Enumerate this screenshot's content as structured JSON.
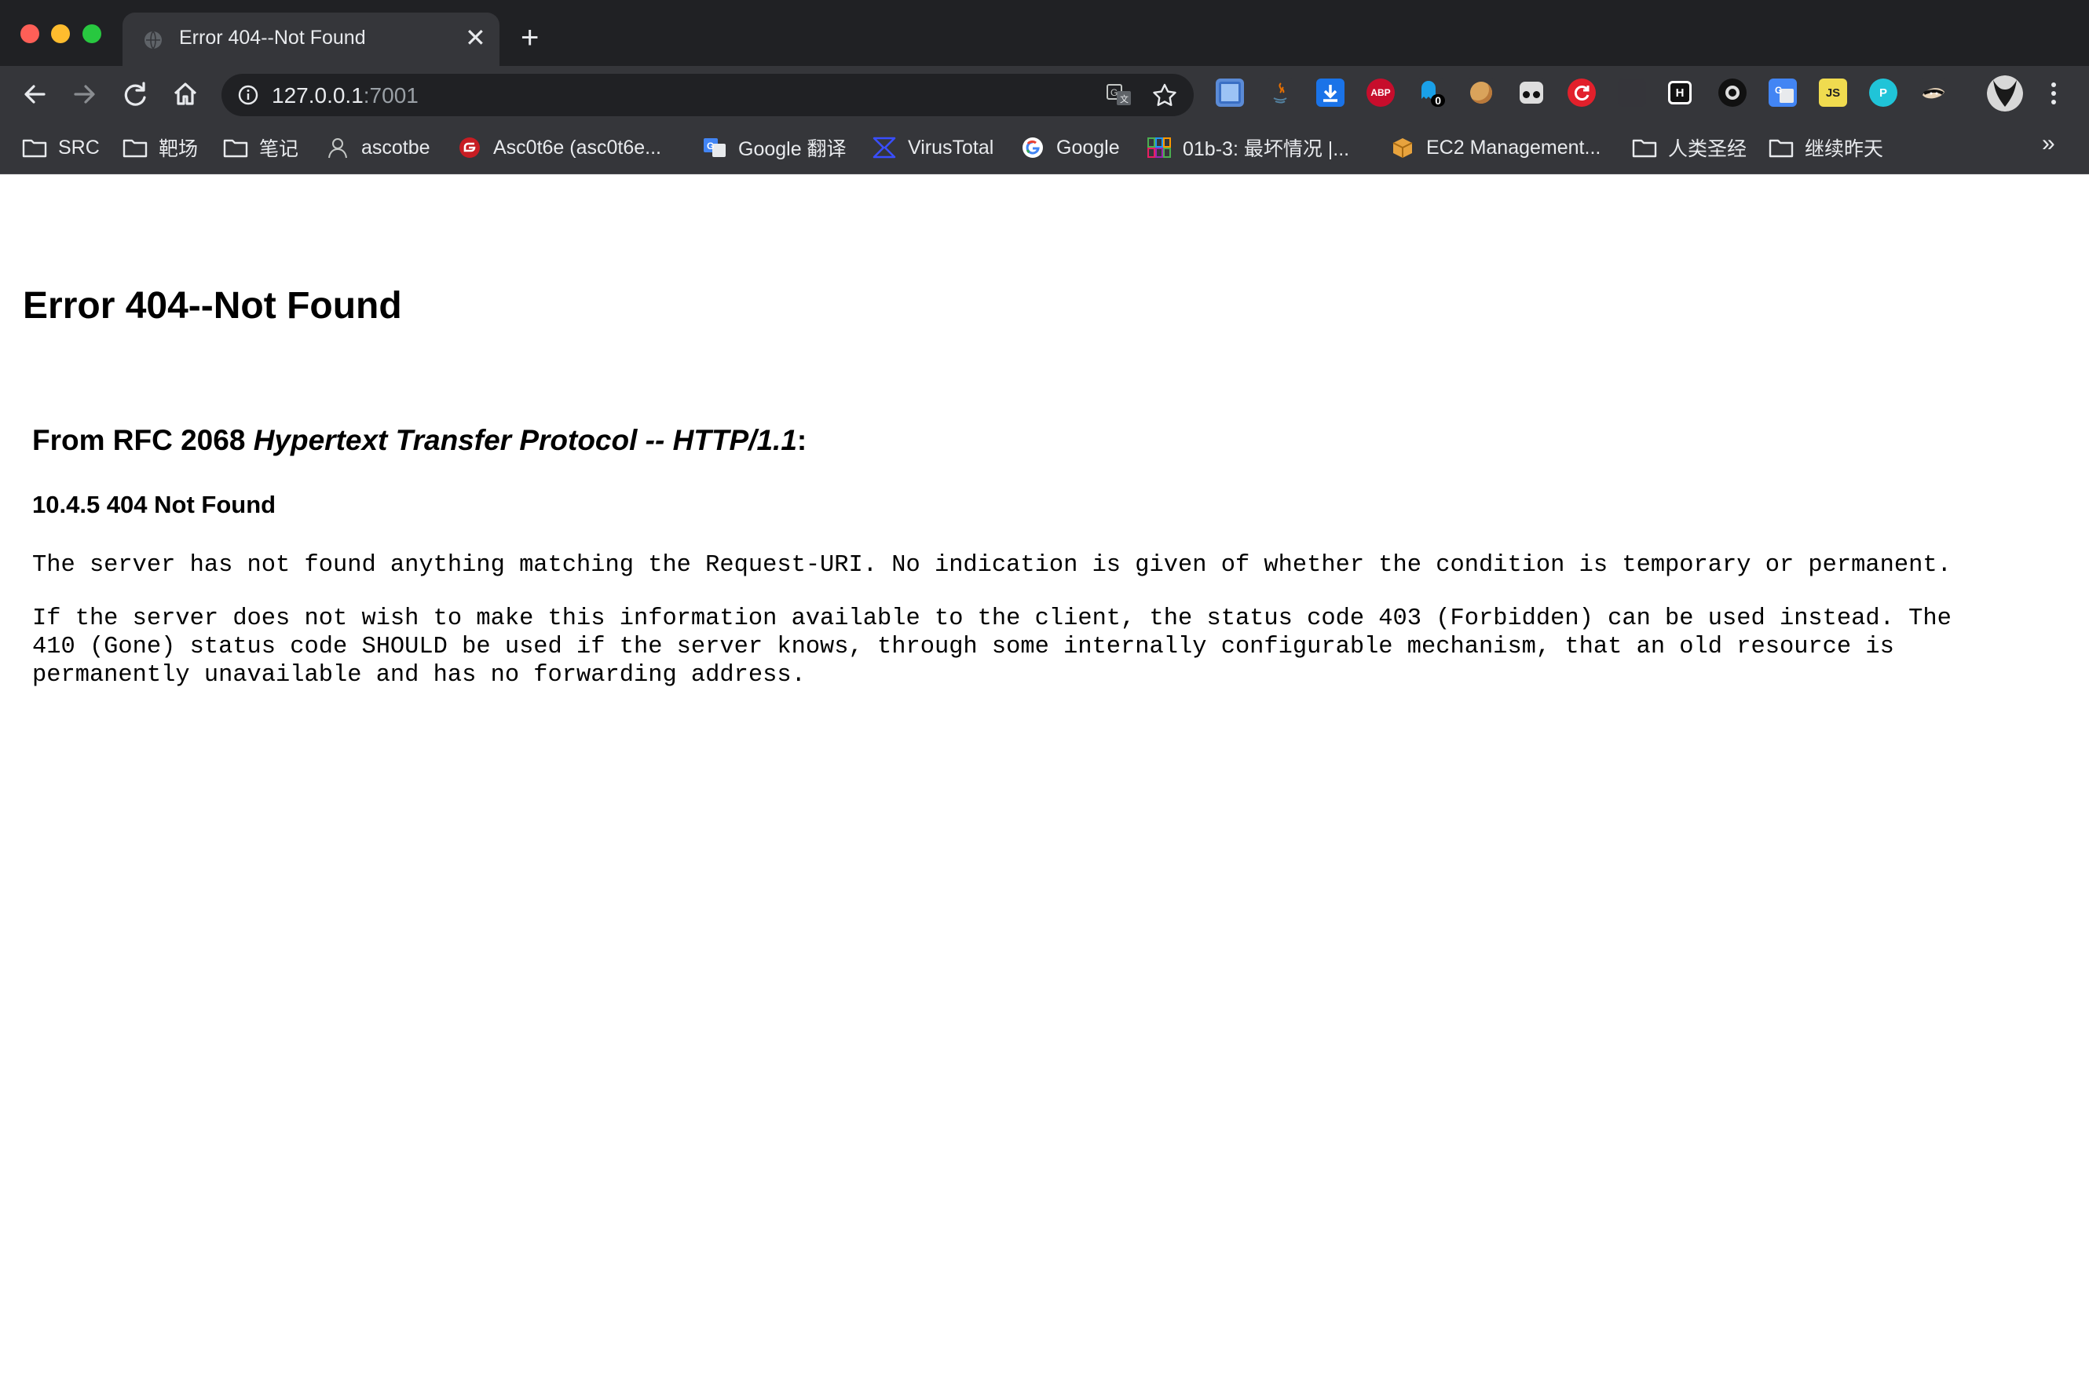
{
  "window": {
    "tab_title": "Error 404--Not Found",
    "tab_close": "✕",
    "new_tab": "+"
  },
  "toolbar": {
    "url_host": "127.0.0.1",
    "url_port": ":7001",
    "extensions": [
      {
        "name": "page-shot-extension",
        "color": "#5b8bd6",
        "label": ""
      },
      {
        "name": "java-extension",
        "color": "#35363a",
        "label": ""
      },
      {
        "name": "download-extension",
        "color": "#1a73e8",
        "label": ""
      },
      {
        "name": "adblock-plus-extension",
        "color": "#c70d2c",
        "label": "ABP"
      },
      {
        "name": "ghostery-extension",
        "color": "#35363a",
        "label": "0"
      },
      {
        "name": "cookie-extension",
        "color": "#35363a",
        "label": ""
      },
      {
        "name": "tampermonkey-extension",
        "color": "#35363a",
        "label": ""
      },
      {
        "name": "refresh-extension",
        "color": "#e2202b",
        "label": ""
      },
      {
        "name": "hidden-extension",
        "color": "#35363a",
        "label": ""
      },
      {
        "name": "hackbar-extension",
        "color": "#111111",
        "label": "H"
      },
      {
        "name": "circle-extension",
        "color": "#111111",
        "label": ""
      },
      {
        "name": "google-translate-extension",
        "color": "#4285f4",
        "label": "G"
      },
      {
        "name": "js-extension",
        "color": "#f0db4f",
        "label": "JS"
      },
      {
        "name": "proxy-extension",
        "color": "#20c4d8",
        "label": "P"
      },
      {
        "name": "ninja-extension",
        "color": "#35363a",
        "label": ""
      }
    ]
  },
  "bookmarks": [
    {
      "name": "bookmark-src",
      "label": "SRC",
      "icon": "folder-icon"
    },
    {
      "name": "bookmark-range",
      "label": "靶场",
      "icon": "folder-icon"
    },
    {
      "name": "bookmark-notes",
      "label": "笔记",
      "icon": "folder-icon"
    },
    {
      "name": "bookmark-ascotbe",
      "label": "ascotbe",
      "icon": "user-icon"
    },
    {
      "name": "bookmark-asc0t6e",
      "label": "Asc0t6e (asc0t6e...",
      "icon": "gitee-icon"
    },
    {
      "name": "bookmark-google-translate",
      "label": "Google 翻译",
      "icon": "translate-icon"
    },
    {
      "name": "bookmark-virustotal",
      "label": "VirusTotal",
      "icon": "virustotal-icon"
    },
    {
      "name": "bookmark-google",
      "label": "Google",
      "icon": "google-icon"
    },
    {
      "name": "bookmark-01b-3",
      "label": "01b-3: 最坏情况 |...",
      "icon": "grid-icon"
    },
    {
      "name": "bookmark-ec2",
      "label": "EC2 Management...",
      "icon": "aws-box-icon"
    },
    {
      "name": "bookmark-scriptures",
      "label": "人类圣经",
      "icon": "folder-icon"
    },
    {
      "name": "bookmark-yesterday",
      "label": "继续昨天",
      "icon": "folder-icon"
    }
  ],
  "bookmarks_more": "»",
  "page": {
    "title": "Error 404--Not Found",
    "rfc_prefix": "From RFC 2068 ",
    "rfc_italic": "Hypertext Transfer Protocol -- HTTP/1.1",
    "rfc_suffix": ":",
    "section_heading": "10.4.5 404 Not Found",
    "paragraph1": "The server has not found anything matching the Request-URI. No indication is given of whether the condition is temporary or permanent.",
    "paragraph2": "If the server does not wish to make this information available to the client, the status code 403 (Forbidden) can be used instead. The\n410 (Gone) status code SHOULD be used if the server knows, through some internally configurable mechanism, that an old resource is\npermanently unavailable and has no forwarding address."
  }
}
